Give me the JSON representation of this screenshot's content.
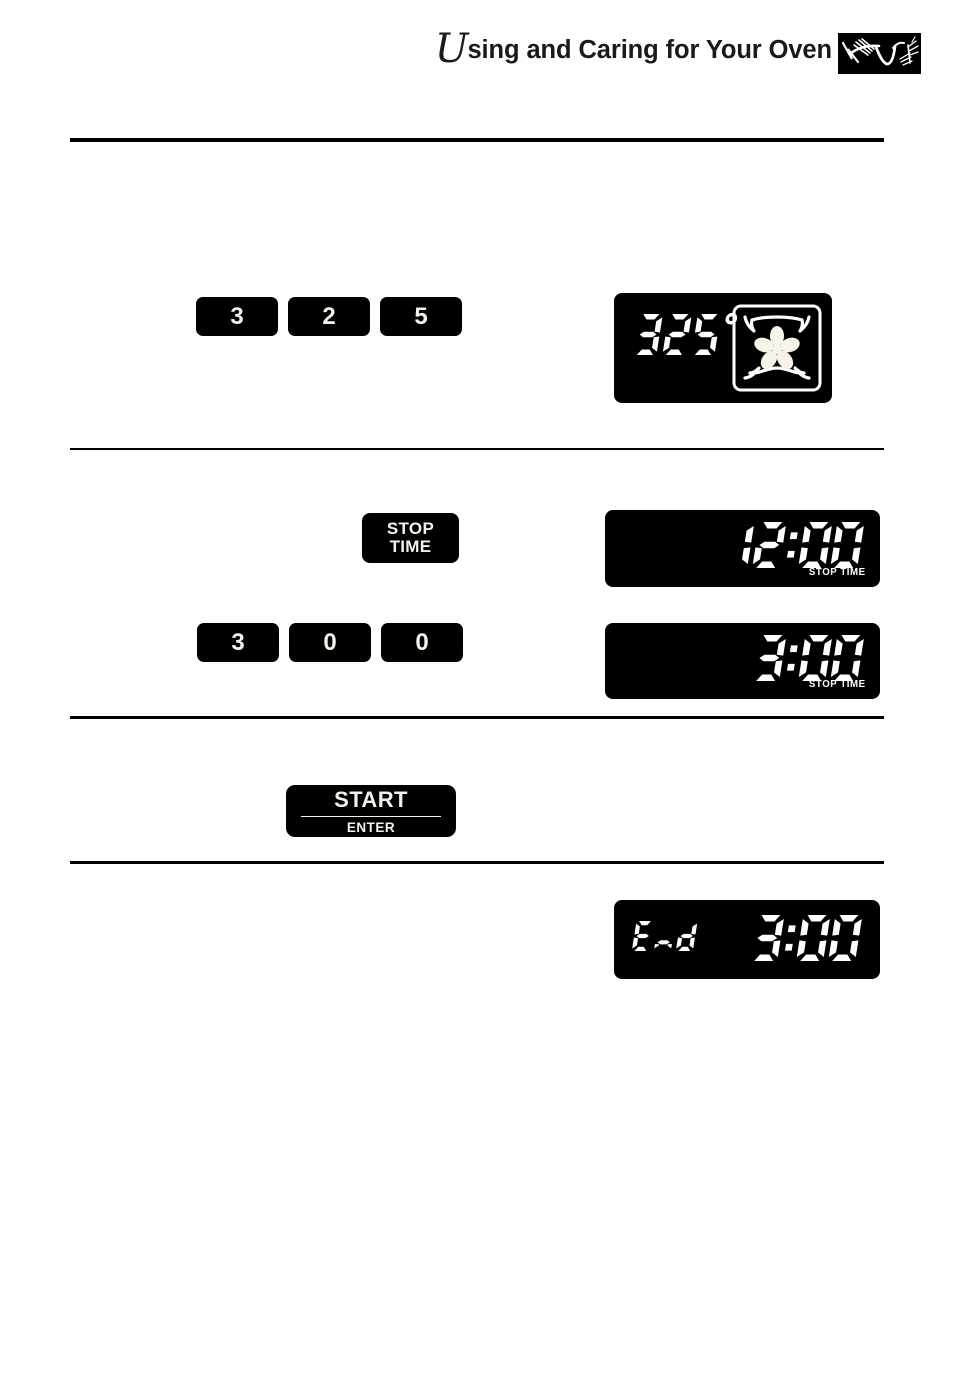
{
  "header": {
    "title_dropcap": "U",
    "title_rest": "sing and Caring for Your Oven",
    "logo_name": "wheat-sheaf-logo"
  },
  "steps": [
    {
      "id": "set-temperature",
      "keypad": {
        "name": "numeric-keypad-325",
        "keys": [
          "3",
          "2",
          "5"
        ]
      },
      "display": {
        "name": "oven-temperature-display",
        "value": "325",
        "degree_symbol": "°",
        "icon": "convection-fan-icon"
      }
    },
    {
      "id": "set-stop-time",
      "button": {
        "name": "stop-time-button",
        "line1": "STOP",
        "line2": "TIME"
      },
      "display": {
        "name": "clock-display",
        "value": "12:00",
        "indicator": "STOP  TIME"
      }
    },
    {
      "id": "enter-stop-time",
      "keypad": {
        "name": "numeric-keypad-300",
        "keys": [
          "3",
          "0",
          "0"
        ]
      },
      "display": {
        "name": "stop-time-display",
        "value": "3:00",
        "indicator": "STOP  TIME"
      }
    },
    {
      "id": "start",
      "button": {
        "name": "start-enter-button",
        "line1": "START",
        "line2": "ENTER"
      }
    },
    {
      "id": "end",
      "display": {
        "name": "end-display",
        "word": "End",
        "value": "3:00"
      }
    }
  ],
  "colors": {
    "panel_background": "#000000",
    "led_text": "#ffffff",
    "key_text": "#f4f1e8",
    "page_background": "#ffffff",
    "rule": "#000000"
  }
}
